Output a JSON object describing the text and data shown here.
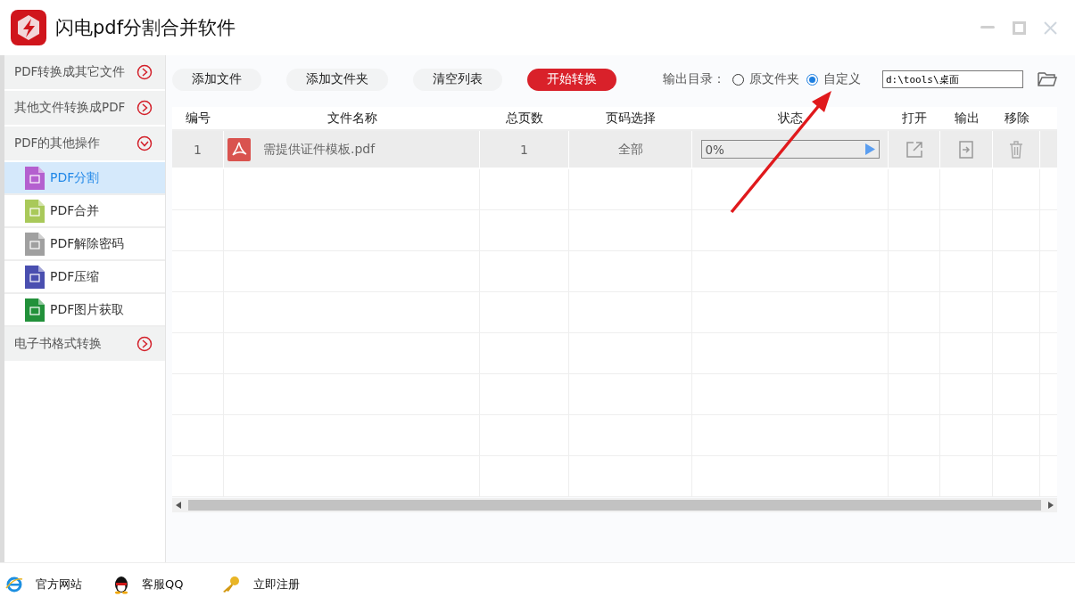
{
  "window": {
    "title": "闪电pdf分割合并软件"
  },
  "sidebar": {
    "groups": [
      {
        "label": "PDF转换成其它文件",
        "expanded": false
      },
      {
        "label": "其他文件转换成PDF",
        "expanded": false
      },
      {
        "label": "PDF的其他操作",
        "expanded": true,
        "children": [
          {
            "label": "PDF分割",
            "selected": true,
            "color": "#b45fcf"
          },
          {
            "label": "PDF合并",
            "selected": false,
            "color": "#a9c95a"
          },
          {
            "label": "PDF解除密码",
            "selected": false,
            "color": "#a0a0a0"
          },
          {
            "label": "PDF压缩",
            "selected": false,
            "color": "#4a4fb0"
          },
          {
            "label": "PDF图片获取",
            "selected": false,
            "color": "#22913a"
          }
        ]
      },
      {
        "label": "电子书格式转换",
        "expanded": false
      }
    ]
  },
  "toolbar": {
    "buttons": [
      {
        "label": "添加文件",
        "primary": false
      },
      {
        "label": "添加文件夹",
        "primary": false
      },
      {
        "label": "清空列表",
        "primary": false
      },
      {
        "label": "开始转换",
        "primary": true
      }
    ],
    "output_label": "输出目录：",
    "output_options": [
      {
        "label": "原文件夹",
        "selected": false
      },
      {
        "label": "自定义",
        "selected": true
      }
    ],
    "output_path": {
      "value": "d:\\tools\\桌面"
    }
  },
  "table": {
    "columns": [
      "编号",
      "文件名称",
      "总页数",
      "页码选择",
      "状态",
      "打开",
      "输出",
      "移除"
    ],
    "rows": [
      {
        "number": "1",
        "file_name": "需提供证件模板.pdf",
        "pages": "1",
        "page_selection": "全部",
        "progress": {
          "level": 0,
          "reading": "0%"
        }
      }
    ]
  },
  "footer": {
    "links": [
      {
        "kind": "website",
        "label": "官方网站"
      },
      {
        "kind": "qq",
        "label": "客服QQ"
      },
      {
        "kind": "register",
        "label": "立即注册"
      }
    ]
  }
}
